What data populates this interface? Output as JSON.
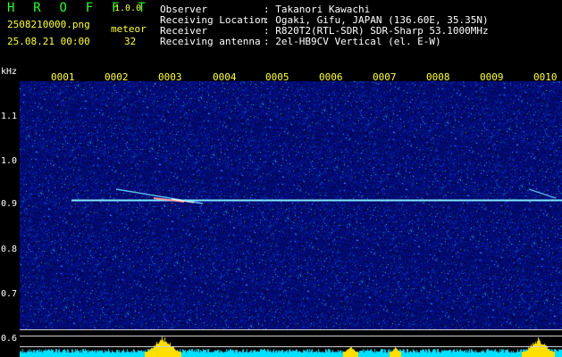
{
  "app": {
    "title": "H R O F F T",
    "version": "1.0.0"
  },
  "file": {
    "name": "2508210000.png",
    "datetime": "25.08.21 00:00"
  },
  "meteor": {
    "label": "meteor",
    "count": "32"
  },
  "info": [
    {
      "key": "Observer",
      "value": ": Takanori Kawachi"
    },
    {
      "key": "Receiving Location",
      "value": ": Ogaki, Gifu, JAPAN (136.60E, 35.35N)"
    },
    {
      "key": "Receiver",
      "value": ": R820T2(RTL-SDR) SDR-Sharp 53.1000MHz"
    },
    {
      "key": "Receiving antenna",
      "value": ": 2el-HB9CV Vertical (el. E-W)"
    }
  ],
  "axis": {
    "unit": "kHz",
    "yticks": [
      "1.1",
      "1.0",
      "0.9",
      "0.8",
      "0.7",
      "0.6"
    ],
    "yvalues": [
      1.1,
      1.0,
      0.9,
      0.8,
      0.7,
      0.6
    ],
    "time_labels": [
      "0001",
      "0002",
      "0003",
      "0004",
      "0005",
      "0006",
      "0007",
      "0008",
      "0009",
      "0010"
    ]
  },
  "colors": {
    "background": "#000000",
    "noise_base": "#0b1a8a",
    "carrier": "#7fe6ff",
    "label_yellow": "#ffff40",
    "title_green": "#29ff29",
    "level_yellow": "#ffe000",
    "level_cyan": "#00ffff"
  }
}
